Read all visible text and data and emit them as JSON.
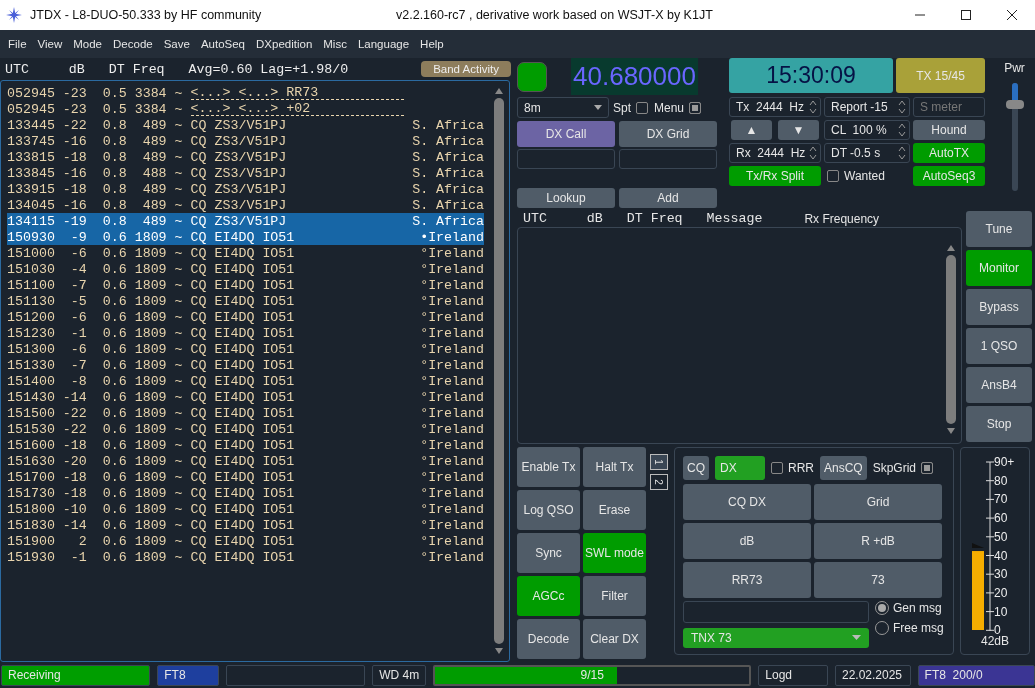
{
  "window": {
    "title": "JTDX - L8-DUO-50.333  by HF community",
    "subtitle": "v2.2.160-rc7 , derivative work based on WSJT-X by K1JT"
  },
  "menu": [
    "File",
    "View",
    "Mode",
    "Decode",
    "Save",
    "AutoSeq",
    "DXpedition",
    "Misc",
    "Language",
    "Help"
  ],
  "band_activity": {
    "header": "UTC     dB   DT Freq   Avg=0.60 Lag=+1.98/0",
    "button": "Band Activity",
    "rows": [
      {
        "text": "052945 -23  0.5 3384 ~",
        "message": "<...> <...> RR73",
        "kind": "dashed",
        "selected": false
      },
      {
        "text": "052945 -23  0.5 3384 ~",
        "message": "<...> <...> +02",
        "kind": "dashed",
        "selected": false
      },
      {
        "text": "133445 -22  0.8  489 ~",
        "message": "CQ ZS3/V51PJ",
        "country": "S. Africa",
        "kind": "plain",
        "selected": false
      },
      {
        "text": "133745 -16  0.8  489 ~",
        "message": "CQ ZS3/V51PJ",
        "country": "S. Africa",
        "kind": "plain",
        "selected": false
      },
      {
        "text": "133815 -18  0.8  489 ~",
        "message": "CQ ZS3/V51PJ",
        "country": "S. Africa",
        "kind": "plain",
        "selected": false
      },
      {
        "text": "133845 -16  0.8  488 ~",
        "message": "CQ ZS3/V51PJ",
        "country": "S. Africa",
        "kind": "plain",
        "selected": false
      },
      {
        "text": "133915 -18  0.8  489 ~",
        "message": "CQ ZS3/V51PJ",
        "country": "S. Africa",
        "kind": "plain",
        "selected": false
      },
      {
        "text": "134045 -16  0.8  489 ~",
        "message": "CQ ZS3/V51PJ",
        "country": "S. Africa",
        "kind": "plain",
        "selected": false
      },
      {
        "text": "134115 -19  0.8  489 ~",
        "message": "CQ ZS3/V51PJ",
        "country": "S. Africa",
        "kind": "plain",
        "selected": true
      },
      {
        "text": "150930  -9  0.6 1809 ~",
        "message": "CQ EI4DQ IO51",
        "country": "•Ireland",
        "kind": "plain",
        "selected": true
      },
      {
        "text": "151000  -6  0.6 1809 ~",
        "message": "CQ EI4DQ IO51",
        "country": "°Ireland",
        "kind": "plain",
        "selected": false
      },
      {
        "text": "151030  -4  0.6 1809 ~",
        "message": "CQ EI4DQ IO51",
        "country": "°Ireland",
        "kind": "plain",
        "selected": false
      },
      {
        "text": "151100  -7  0.6 1809 ~",
        "message": "CQ EI4DQ IO51",
        "country": "°Ireland",
        "kind": "plain",
        "selected": false
      },
      {
        "text": "151130  -5  0.6 1809 ~",
        "message": "CQ EI4DQ IO51",
        "country": "°Ireland",
        "kind": "plain",
        "selected": false
      },
      {
        "text": "151200  -6  0.6 1809 ~",
        "message": "CQ EI4DQ IO51",
        "country": "°Ireland",
        "kind": "plain",
        "selected": false
      },
      {
        "text": "151230  -1  0.6 1809 ~",
        "message": "CQ EI4DQ IO51",
        "country": "°Ireland",
        "kind": "plain",
        "selected": false
      },
      {
        "text": "151300  -6  0.6 1809 ~",
        "message": "CQ EI4DQ IO51",
        "country": "°Ireland",
        "kind": "plain",
        "selected": false
      },
      {
        "text": "151330  -7  0.6 1809 ~",
        "message": "CQ EI4DQ IO51",
        "country": "°Ireland",
        "kind": "plain",
        "selected": false
      },
      {
        "text": "151400  -8  0.6 1809 ~",
        "message": "CQ EI4DQ IO51",
        "country": "°Ireland",
        "kind": "plain",
        "selected": false
      },
      {
        "text": "151430 -14  0.6 1809 ~",
        "message": "CQ EI4DQ IO51",
        "country": "°Ireland",
        "kind": "plain",
        "selected": false
      },
      {
        "text": "151500 -22  0.6 1809 ~",
        "message": "CQ EI4DQ IO51",
        "country": "°Ireland",
        "kind": "plain",
        "selected": false
      },
      {
        "text": "151530 -22  0.6 1809 ~",
        "message": "CQ EI4DQ IO51",
        "country": "°Ireland",
        "kind": "plain",
        "selected": false
      },
      {
        "text": "151600 -18  0.6 1809 ~",
        "message": "CQ EI4DQ IO51",
        "country": "°Ireland",
        "kind": "plain",
        "selected": false
      },
      {
        "text": "151630 -20  0.6 1809 ~",
        "message": "CQ EI4DQ IO51",
        "country": "°Ireland",
        "kind": "plain",
        "selected": false
      },
      {
        "text": "151700 -18  0.6 1809 ~",
        "message": "CQ EI4DQ IO51",
        "country": "°Ireland",
        "kind": "plain",
        "selected": false
      },
      {
        "text": "151730 -18  0.6 1809 ~",
        "message": "CQ EI4DQ IO51",
        "country": "°Ireland",
        "kind": "plain",
        "selected": false
      },
      {
        "text": "151800 -10  0.6 1809 ~",
        "message": "CQ EI4DQ IO51",
        "country": "°Ireland",
        "kind": "plain",
        "selected": false
      },
      {
        "text": "151830 -14  0.6 1809 ~",
        "message": "CQ EI4DQ IO51",
        "country": "°Ireland",
        "kind": "plain",
        "selected": false
      },
      {
        "text": "151900   2  0.6 1809 ~",
        "message": "CQ EI4DQ IO51",
        "country": "°Ireland",
        "kind": "plain",
        "selected": false
      },
      {
        "text": "151930  -1  0.6 1809 ~",
        "message": "CQ EI4DQ IO51",
        "country": "°Ireland",
        "kind": "plain",
        "selected": false
      }
    ]
  },
  "status_light": {
    "on": true
  },
  "frequency": "40.680000",
  "clock": "15:30:09",
  "tx_period": "TX 15/45",
  "band": "8m",
  "checks": [
    {
      "label": "Spt",
      "checked": false
    },
    {
      "label": "Menu",
      "checked": true
    }
  ],
  "dx_buttons": [
    {
      "label": "DX Call",
      "on": true
    },
    {
      "label": "DX Grid",
      "on": false
    }
  ],
  "lookup_buttons": [
    "Lookup",
    "Add"
  ],
  "controls": [
    {
      "kind": "spin",
      "text": "Tx  2444  Hz"
    },
    {
      "kind": "spin",
      "text": "Report -15"
    },
    {
      "kind": "field",
      "placeholder": "S meter"
    },
    {
      "kind": "arrows",
      "up": "▲",
      "down": "▼"
    },
    {
      "kind": "spin",
      "text": "CL  100 %"
    },
    {
      "kind": "button",
      "text": "Hound",
      "on": false
    },
    {
      "kind": "spin",
      "text": "Rx  2444  Hz"
    },
    {
      "kind": "spin",
      "text": "DT -0.5 s"
    },
    {
      "kind": "button",
      "text": "AutoTX",
      "on": true
    },
    {
      "kind": "button",
      "text": "Tx/Rx Split",
      "on": true
    },
    {
      "kind": "checkbox",
      "text": "Wanted",
      "checked": false
    },
    {
      "kind": "button",
      "text": "AutoSeq3",
      "on": true
    }
  ],
  "power": {
    "label": "Pwr",
    "level": 0.8
  },
  "rx_frequency": {
    "header": "UTC     dB   DT Freq   Message",
    "title": "Rx Frequency"
  },
  "side_buttons": [
    {
      "label": "Tune",
      "on": false
    },
    {
      "label": "Monitor",
      "on": true
    },
    {
      "label": "Bypass",
      "on": false
    },
    {
      "label": "1 QSO",
      "on": false
    },
    {
      "label": "AnsB4",
      "on": false
    },
    {
      "label": "Stop",
      "on": false
    }
  ],
  "action_buttons": [
    {
      "label": "Enable Tx",
      "on": false
    },
    {
      "label": "Halt Tx",
      "on": false
    },
    {
      "label": "Log QSO",
      "on": false
    },
    {
      "label": "Erase",
      "on": false
    },
    {
      "label": "Sync",
      "on": false
    },
    {
      "label": "SWL mode",
      "on": true
    },
    {
      "label": "AGCc",
      "on": true
    },
    {
      "label": "Filter",
      "on": false
    },
    {
      "label": "Decode",
      "on": false
    },
    {
      "label": "Clear DX",
      "on": false
    }
  ],
  "tabs": [
    {
      "label": "1",
      "selected": true
    },
    {
      "label": "2",
      "selected": false
    }
  ],
  "tx_panel": {
    "top": [
      {
        "kind": "button",
        "label": "CQ",
        "on": false
      },
      {
        "kind": "wide_button",
        "label": "DX",
        "on": true
      },
      {
        "kind": "checkbox",
        "label": "RRR",
        "checked": false
      },
      {
        "kind": "button",
        "label": "AnsCQ",
        "on": false
      },
      {
        "kind": "checkbox_right",
        "label": "SkpGrid",
        "checked": true
      }
    ],
    "messages": [
      "CQ DX",
      "Grid",
      "dB",
      "R +dB",
      "RR73",
      "73"
    ],
    "dropdown": "TNX 73",
    "radios": [
      {
        "label": "Gen msg",
        "selected": true
      },
      {
        "label": "Free msg",
        "selected": false
      }
    ]
  },
  "meter": {
    "scale": [
      "90+",
      "80",
      "70",
      "60",
      "50",
      "40",
      "30",
      "20",
      "10",
      "0"
    ],
    "level": 0.47,
    "reading": "42dB"
  },
  "status_bar": [
    {
      "kind": "label",
      "text": "Receiving",
      "color": "#009e00"
    },
    {
      "kind": "label",
      "text": "FT8",
      "color": "#1e3f9e"
    },
    {
      "kind": "empty"
    },
    {
      "kind": "label",
      "text": "WD 4m"
    },
    {
      "kind": "progress",
      "text": "9/15",
      "level": 0.58
    },
    {
      "kind": "label",
      "text": "Logd"
    },
    {
      "kind": "label",
      "text": "22.02.2025"
    },
    {
      "kind": "label",
      "text": "FT8  200/0",
      "color": "#3b3594"
    }
  ]
}
